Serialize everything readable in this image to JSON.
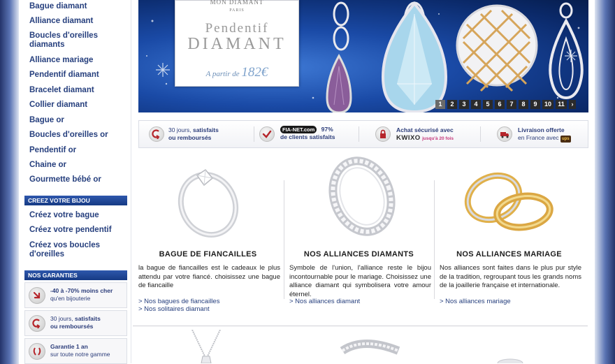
{
  "sidebar": {
    "links": [
      {
        "label": "Bague diamant"
      },
      {
        "label": "Alliance diamant"
      },
      {
        "label": "Boucles d'oreilles diamants"
      },
      {
        "label": "Alliance mariage"
      },
      {
        "label": "Pendentif diamant"
      },
      {
        "label": "Bracelet diamant"
      },
      {
        "label": "Collier diamant"
      },
      {
        "label": "Bague or"
      },
      {
        "label": "Boucles d'oreilles or"
      },
      {
        "label": "Pendentif or"
      },
      {
        "label": "Chaine or"
      },
      {
        "label": "Gourmette bébé or"
      }
    ],
    "create_heading": "CREEZ VOTRE BIJOU",
    "create_links": [
      {
        "label": "Créez votre bague"
      },
      {
        "label": "Créez votre pendentif"
      },
      {
        "label": "Créez vos boucles d'oreilles"
      }
    ],
    "guarantees_heading": "NOS GARANTIES",
    "guarantees": [
      {
        "line1": "-40 à -70% moins cher",
        "line2": "qu'en bijouterie",
        "icon": "arrow-down-icon"
      },
      {
        "line1_pre": "30 jours, ",
        "line1_bold": "satisfaits",
        "line2": "ou remboursés",
        "icon": "return-arrow-icon"
      },
      {
        "line1": "Garantie 1 an",
        "line2": "sur toute notre gamme",
        "icon": "laurel-icon"
      }
    ]
  },
  "banner": {
    "brand": "MON DIAMANT",
    "brand_sub": "PARIS",
    "title_line1": "Pendentif",
    "title_line2": "DIAMANT",
    "price_prefix": "A partir de",
    "price": "182€",
    "pages": [
      "1",
      "2",
      "3",
      "4",
      "5",
      "6",
      "7",
      "8",
      "9",
      "10",
      "11"
    ],
    "active_page": "1",
    "more": "›"
  },
  "assurance": [
    {
      "pre": "30 jours, ",
      "bold": "satisfaits",
      "line2": "ou remboursés",
      "icon": "return-arrow-icon"
    },
    {
      "logo": "FIA-NET.com",
      "pct": "97%",
      "line2": "de clients satisfaits",
      "icon": "check-icon"
    },
    {
      "line1": "Achat sécurisé avec",
      "kwixo": "KWIXO",
      "kwixo_sub": "jusqu'à 20 fois",
      "icon": "lock-icon"
    },
    {
      "line1": "Livraison offerte",
      "line2": "en France avec",
      "ups": "ups",
      "icon": "truck-icon"
    }
  ],
  "products": [
    {
      "title": "BAGUE DE FIANCAILLES",
      "description": "la bague de fiancailles est le cadeaux le plus attendu par votre fiancé. choisissez une bague de fiancaille",
      "links": [
        "> Nos bagues de fiancailles",
        "> Nos solitaires diamant"
      ]
    },
    {
      "title": "NOS ALLIANCES DIAMANTS",
      "description": "Symbole de l'union, l'alliance reste le bijou incontournable pour le mariage. Choisissez une alliance diamant qui symbolisera votre amour éternel.",
      "links": [
        "> Nos alliances diamant"
      ]
    },
    {
      "title": "NOS ALLIANCES MARIAGE",
      "description": "Nos alliances sont faites dans le plus pur style de la tradition, regroupant tous les grands noms de la joaillerie française et internationale.",
      "links": [
        "> Nos alliances mariage"
      ]
    }
  ]
}
